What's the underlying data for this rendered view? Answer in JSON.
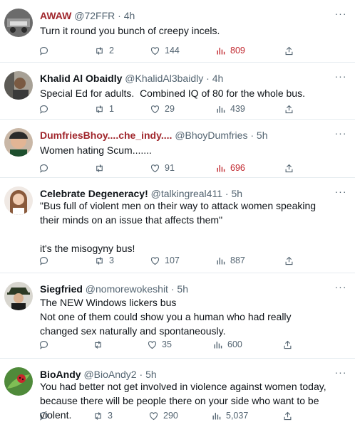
{
  "tweets": [
    {
      "name": "AWAW",
      "handle": "@72FFR",
      "time": "4h",
      "text": "Turn it round you bunch of creepy incels.",
      "replies": "",
      "retweets": "2",
      "likes": "144",
      "views": "809",
      "views_highlight": true,
      "name_color": "#a0262c"
    },
    {
      "name": "Khalid Al Obaidly",
      "handle": "@KhalidAl3baidly",
      "time": "4h",
      "text": "Special Ed for adults.  Combined IQ of 80 for the whole bus.",
      "replies": "",
      "retweets": "1",
      "likes": "29",
      "views": "439",
      "views_highlight": false,
      "name_color": "#0f1419"
    },
    {
      "name": "DumfriesBhoy....che_indy....",
      "handle": "@BhoyDumfries",
      "time": "5h",
      "text": "Women hating Scum.......",
      "replies": "",
      "retweets": "",
      "likes": "91",
      "views": "696",
      "views_highlight": true,
      "name_color": "#a0262c"
    },
    {
      "name": "Celebrate Degeneracy!",
      "handle": "@talkingreal411",
      "time": "5h",
      "text": "\"Bus full of violent men on their way to attack women speaking their minds on an issue that affects them\"\n\nit's the misogyny bus!",
      "replies": "",
      "retweets": "3",
      "likes": "107",
      "views": "887",
      "views_highlight": false,
      "name_color": "#0f1419"
    },
    {
      "name": "Siegfried",
      "handle": "@nomorewokeshit",
      "time": "5h",
      "text": "The NEW Windows lickers bus\nNot one of them could show you a human who had really changed sex naturally and spontaneously.",
      "replies": "",
      "retweets": "",
      "likes": "35",
      "views": "600",
      "views_highlight": false,
      "name_color": "#0f1419"
    },
    {
      "name": "BioAndy",
      "handle": "@BioAndy2",
      "time": "5h",
      "text": "You had better not get involved in violence against women today, because there will be people there on your side who want to be violent.",
      "replies": "",
      "retweets": "3",
      "likes": "290",
      "views": "5,037",
      "views_highlight": false,
      "name_color": "#0f1419"
    }
  ],
  "ui": {
    "more_glyph": "···",
    "separator": "·"
  }
}
